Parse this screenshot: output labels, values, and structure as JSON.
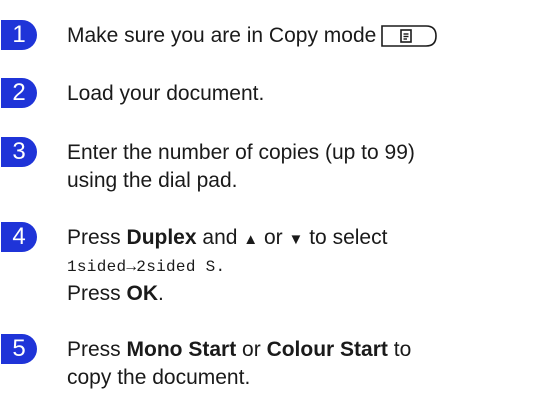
{
  "steps": [
    {
      "number": "1",
      "text": "Make sure you are in Copy mode",
      "key_icon": "copy-mode-key-icon"
    },
    {
      "number": "2",
      "text": "Load your document."
    },
    {
      "number": "3",
      "line1": "Enter the number of copies (up to 99)",
      "line2": "using the dial pad."
    },
    {
      "number": "4",
      "press": "Press",
      "duplex": "Duplex",
      "and": "and",
      "up_arrow": "▲",
      "or": "or",
      "down_arrow": "▼",
      "to_select": "to select",
      "lcd_option": "1sided→2sided S.",
      "press2": "Press",
      "ok": "OK",
      "period": "."
    },
    {
      "number": "5",
      "press": "Press",
      "mono_start": "Mono Start",
      "or": "or",
      "colour_start": "Colour Start",
      "to": "to",
      "line2": "copy the document."
    }
  ],
  "colors": {
    "badge": "#1f34d8",
    "text": "#1a1a1a"
  }
}
